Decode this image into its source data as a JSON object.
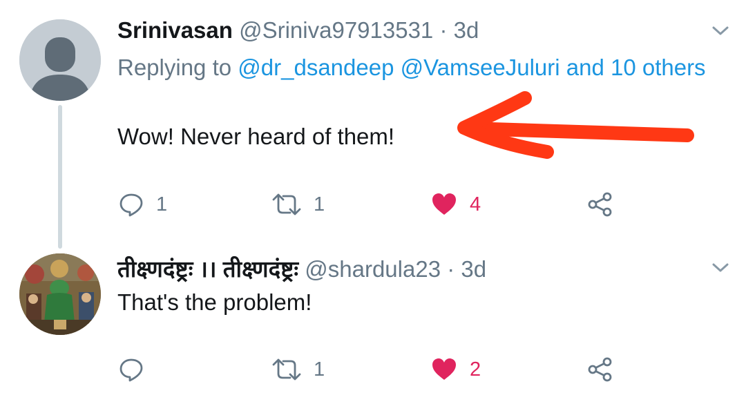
{
  "colors": {
    "name": "#14171a",
    "secondary": "#657786",
    "link": "#1b95e0",
    "like": "#e0245e",
    "annotation_arrow": "#ff3814",
    "thread_line": "#cfd9de"
  },
  "tweets": [
    {
      "display_name": "Srinivasan",
      "handle": "@Sriniva97913531",
      "separator": "·",
      "time": "3d",
      "replying_prefix": "Replying to ",
      "replying_mentions": "@dr_dsandeep @VamseeJuluri and 10 others",
      "text": "Wow! Never heard of them!",
      "reply_count": "1",
      "retweet_count": "1",
      "like_count": "4",
      "liked": true,
      "avatar_icon": "default-profile-icon"
    },
    {
      "display_name": "तीक्ष्णदंष्ट्रः ।। तीक्ष्णदंष्ट्रः",
      "handle": "@shardula23",
      "separator": "·",
      "time": "3d",
      "text": "That's the problem!",
      "reply_count": "",
      "retweet_count": "1",
      "like_count": "2",
      "liked": true,
      "avatar_icon": "painting-avatar-image"
    }
  ]
}
